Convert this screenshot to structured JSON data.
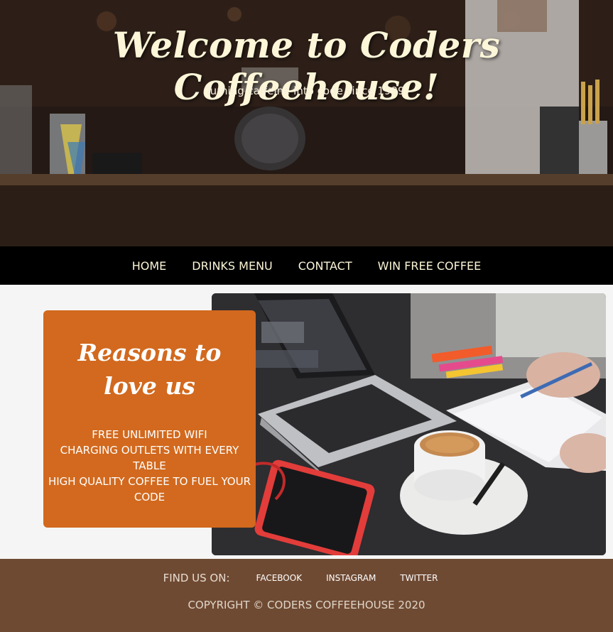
{
  "hero": {
    "title": "Welcome to Coders Coffeehouse!",
    "subtitle": "Turning caffeine into code since 1999."
  },
  "nav": {
    "items": [
      "HOME",
      "DRINKS MENU",
      "CONTACT",
      "WIN FREE COFFEE"
    ]
  },
  "reasons": {
    "title": "Reasons to love us",
    "items": [
      "FREE UNLIMITED WIFI",
      "CHARGING OUTLETS WITH EVERY TABLE",
      "HIGH QUALITY COFFEE TO FUEL YOUR CODE"
    ]
  },
  "footer": {
    "find_label": "FIND US ON:",
    "social": [
      "FACEBOOK",
      "INSTAGRAM",
      "TWITTER"
    ],
    "copyright": "COPYRIGHT © CODERS COFFEEHOUSE 2020"
  },
  "colors": {
    "nav_bg": "#000000",
    "card_bg": "#d2691e",
    "footer_bg": "#6f4a33",
    "nav_text": "#fbf5d6"
  }
}
